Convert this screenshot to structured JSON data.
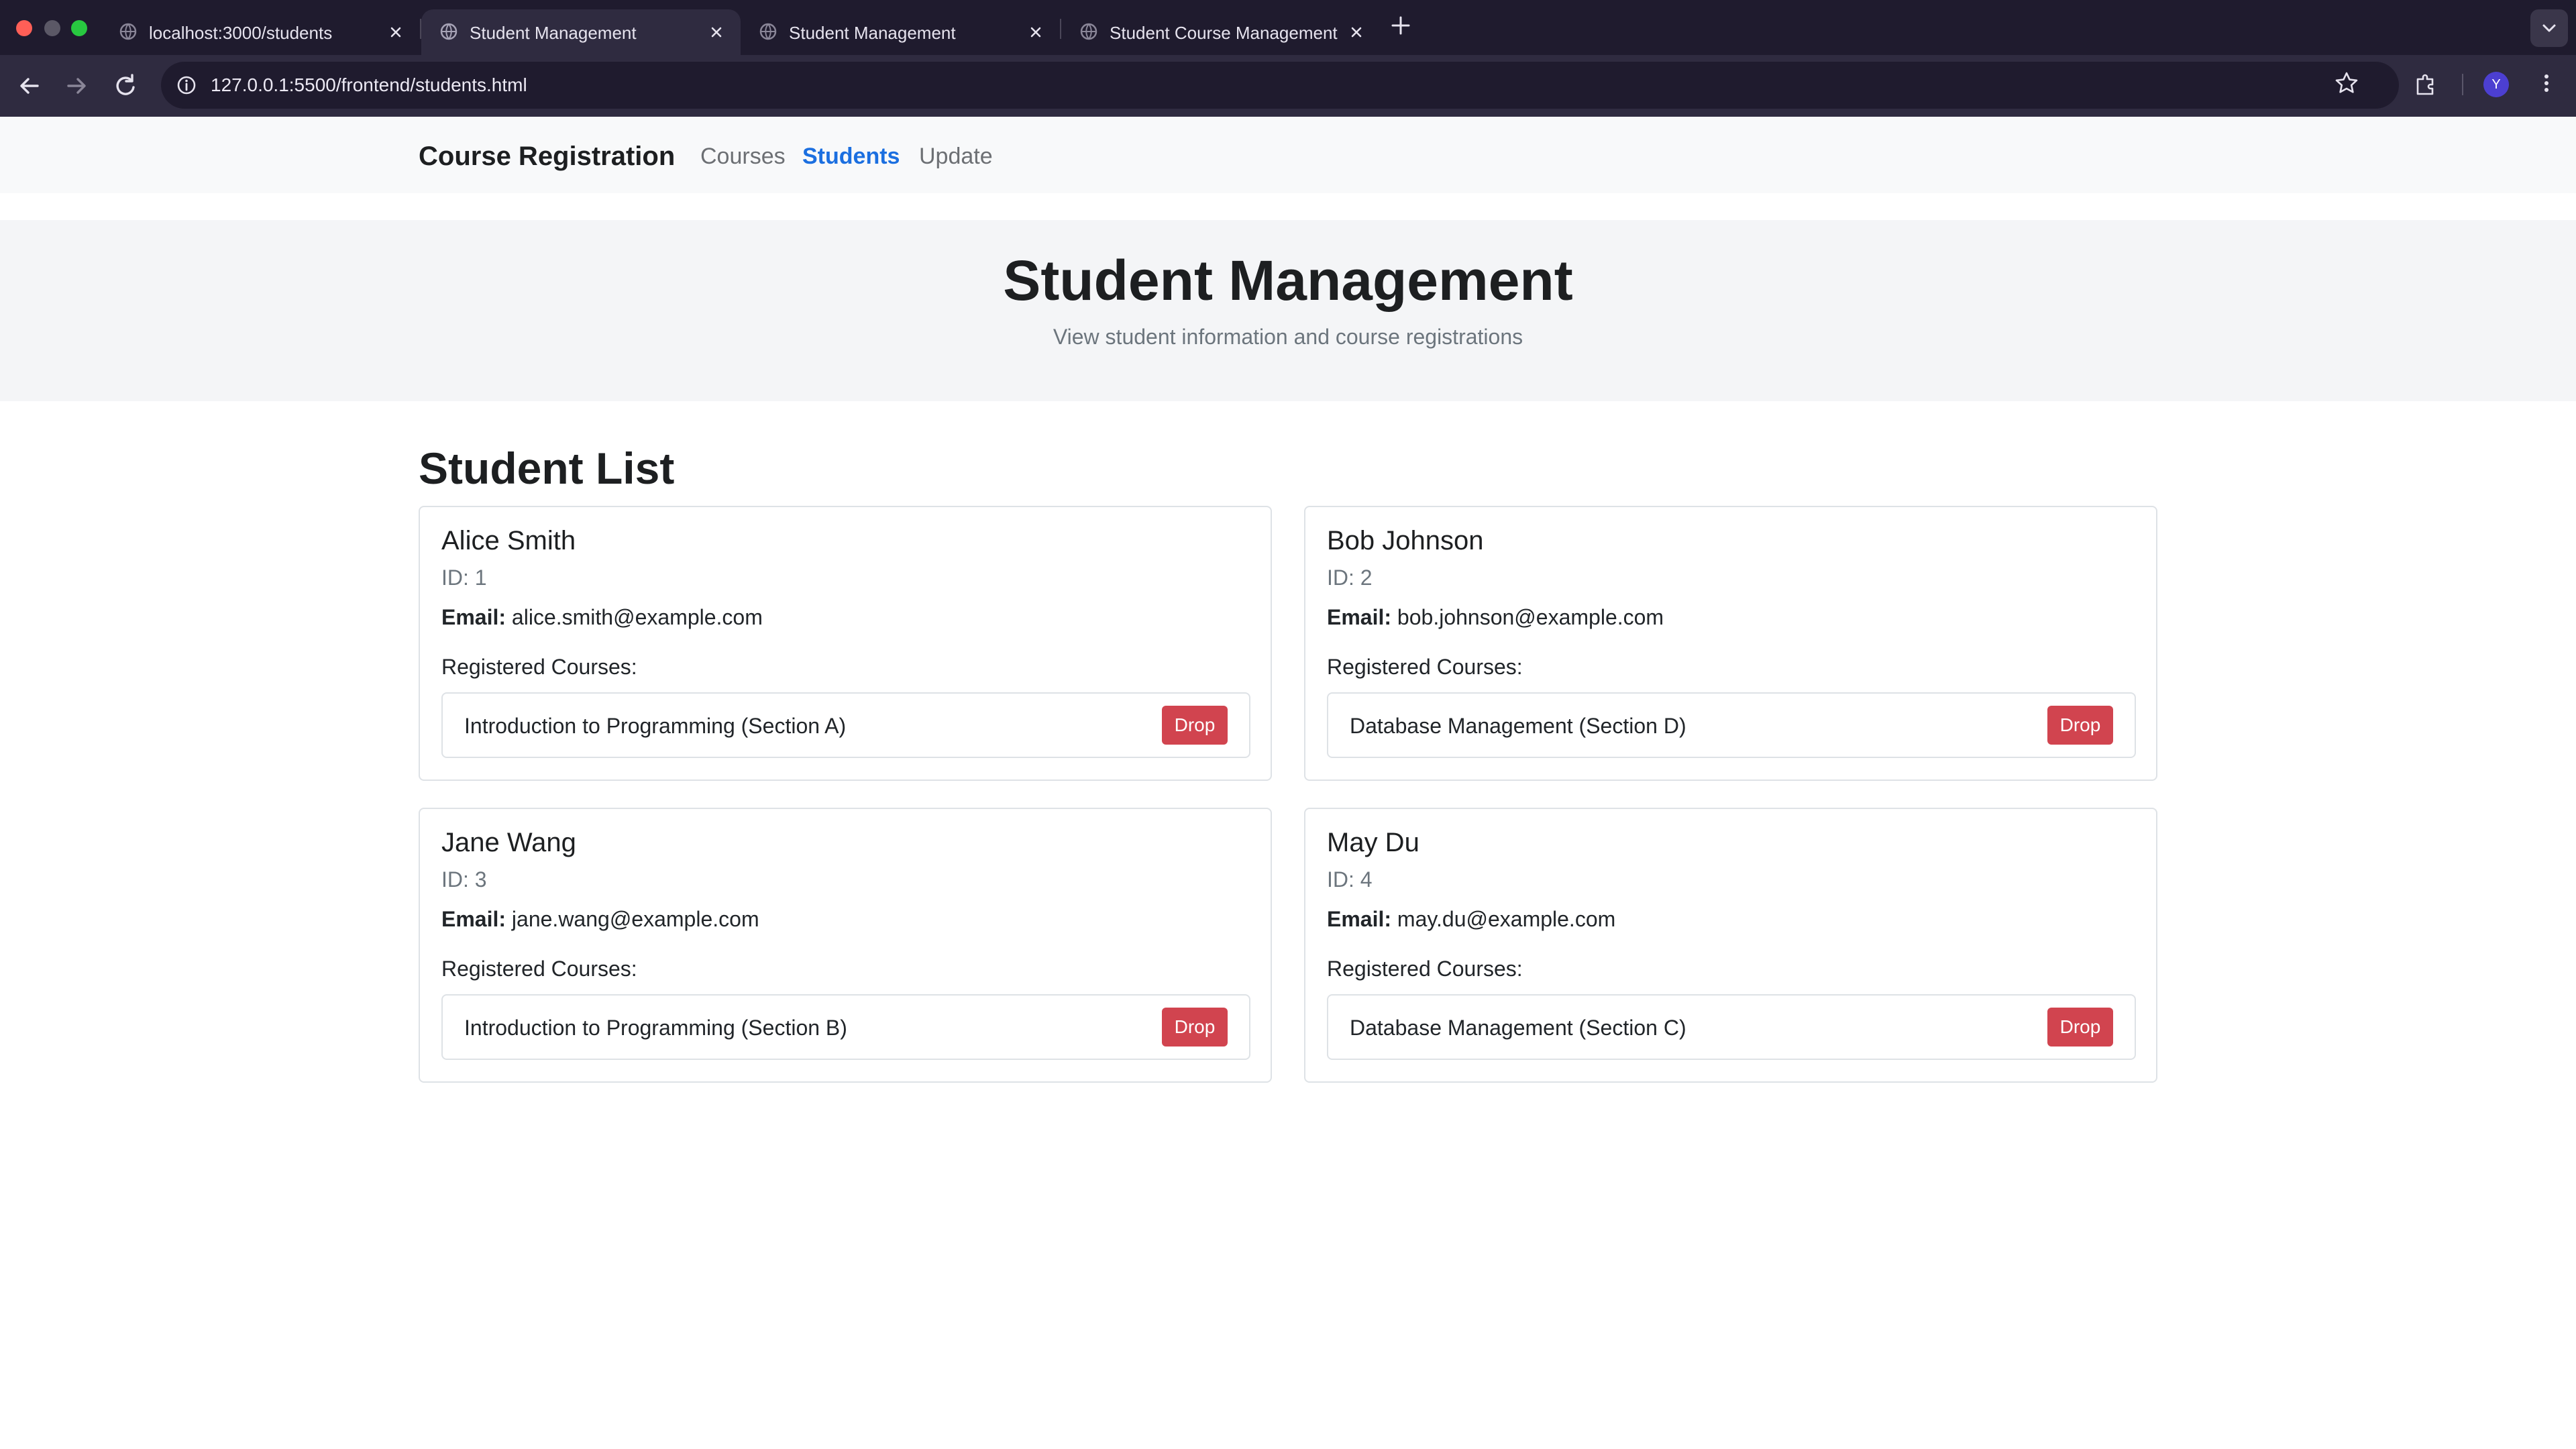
{
  "browser": {
    "tabs": [
      {
        "title": "localhost:3000/students",
        "active": false
      },
      {
        "title": "Student Management",
        "active": true
      },
      {
        "title": "Student Management",
        "active": false
      },
      {
        "title": "Student Course Management",
        "active": false
      }
    ],
    "address_bar": {
      "url": "127.0.0.1:5500/frontend/students.html"
    },
    "profile_initial": "Y",
    "colors": {
      "chrome_dark": "#1f1b2e",
      "chrome_toolbar": "#2f2b40",
      "profile": "#4c3fd1"
    }
  },
  "navbar": {
    "brand": "Course Registration",
    "links": [
      {
        "label": "Courses",
        "active": false
      },
      {
        "label": "Students",
        "active": true
      },
      {
        "label": "Update",
        "active": false
      }
    ]
  },
  "hero": {
    "title": "Student Management",
    "subtitle": "View student information and course registrations"
  },
  "student_list": {
    "title": "Student List",
    "email_label": "Email:",
    "courses_label": "Registered Courses:",
    "drop_label": "Drop",
    "students": [
      {
        "name": "Alice Smith",
        "id": "ID: 1",
        "email": "alice.smith@example.com",
        "courses": [
          "Introduction to Programming (Section A)"
        ]
      },
      {
        "name": "Bob Johnson",
        "id": "ID: 2",
        "email": "bob.johnson@example.com",
        "courses": [
          "Database Management (Section D)"
        ]
      },
      {
        "name": "Jane Wang",
        "id": "ID: 3",
        "email": "jane.wang@example.com",
        "courses": [
          "Introduction to Programming (Section B)"
        ]
      },
      {
        "name": "May Du",
        "id": "ID: 4",
        "email": "may.du@example.com",
        "courses": [
          "Database Management (Section C)"
        ]
      }
    ]
  },
  "theme": {
    "accent": "#1b6fe0",
    "danger": "#d1444f",
    "border": "#dee2e6",
    "muted": "#6c757d"
  }
}
